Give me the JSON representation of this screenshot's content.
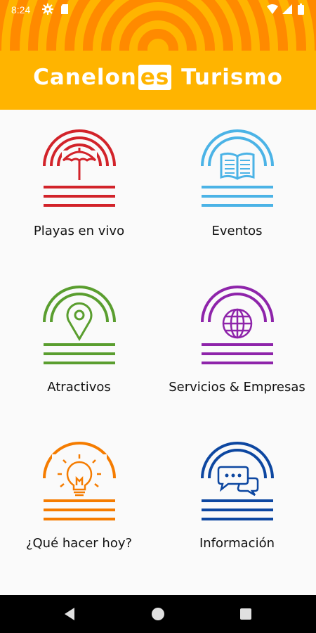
{
  "status_bar": {
    "time": "8:24"
  },
  "header": {
    "brand_part1": "Canelon",
    "brand_boxed": "es",
    "brand_part2": " Turismo",
    "background_color": "#ffb400",
    "ring_color": "#ff8a00"
  },
  "menu": [
    {
      "label": "Playas en vivo",
      "icon": "umbrella-icon",
      "color": "#d2232a"
    },
    {
      "label": "Eventos",
      "icon": "book-icon",
      "color": "#4bb3e6"
    },
    {
      "label": "Atractivos",
      "icon": "location-pin-icon",
      "color": "#5a9e2f"
    },
    {
      "label": "Servicios & Empresas",
      "icon": "globe-icon",
      "color": "#8e24aa"
    },
    {
      "label": "¿Qué hacer hoy?",
      "icon": "lightbulb-icon",
      "color": "#f57c00"
    },
    {
      "label": "Información",
      "icon": "chat-bubbles-icon",
      "color": "#0d47a1"
    }
  ],
  "nav": {
    "back": "back-icon",
    "home": "home-icon",
    "recents": "recents-icon"
  }
}
